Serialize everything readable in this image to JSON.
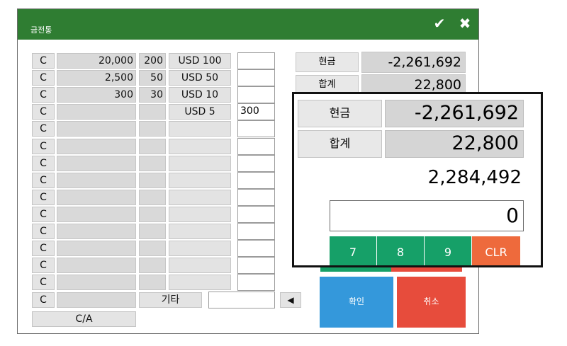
{
  "window": {
    "title": "금전통"
  },
  "icons": {
    "confirm": "check-icon",
    "close": "close-icon",
    "back": "arrow-left-icon"
  },
  "colors": {
    "titlebar": "#2f7d32",
    "confirm": "#3498db",
    "cancel": "#e74c3c",
    "keypad_green": "#16a068",
    "keypad_clr": "#ee6a3c"
  },
  "rows": [
    {
      "clear": "C",
      "amount": "20,000",
      "count": "200",
      "label": "USD 100",
      "input": ""
    },
    {
      "clear": "C",
      "amount": "2,500",
      "count": "50",
      "label": "USD 50",
      "input": ""
    },
    {
      "clear": "C",
      "amount": "300",
      "count": "30",
      "label": "USD 10",
      "input": ""
    },
    {
      "clear": "C",
      "amount": "",
      "count": "",
      "label": "USD 5",
      "input": "300"
    },
    {
      "clear": "C",
      "amount": "",
      "count": "",
      "label": "",
      "input": ""
    },
    {
      "clear": "C",
      "amount": "",
      "count": "",
      "label": "",
      "input": ""
    },
    {
      "clear": "C",
      "amount": "",
      "count": "",
      "label": "",
      "input": ""
    },
    {
      "clear": "C",
      "amount": "",
      "count": "",
      "label": "",
      "input": ""
    },
    {
      "clear": "C",
      "amount": "",
      "count": "",
      "label": "",
      "input": ""
    },
    {
      "clear": "C",
      "amount": "",
      "count": "",
      "label": "",
      "input": ""
    },
    {
      "clear": "C",
      "amount": "",
      "count": "",
      "label": "",
      "input": ""
    },
    {
      "clear": "C",
      "amount": "",
      "count": "",
      "label": "",
      "input": ""
    },
    {
      "clear": "C",
      "amount": "",
      "count": "",
      "label": "",
      "input": ""
    },
    {
      "clear": "C",
      "amount": "",
      "count": "",
      "label": "",
      "input": ""
    }
  ],
  "last_row": {
    "clear": "C",
    "other_label": "기타",
    "other_input": "",
    "back_symbol": "◀"
  },
  "ca_button": "C/A",
  "summary": {
    "cash_label": "현금",
    "cash_value": "-2,261,692",
    "total_label": "합계",
    "total_value": "22,800",
    "difference": "2,284,492",
    "entry_value": "0"
  },
  "keypad": [
    "7",
    "8",
    "9",
    "CLR"
  ],
  "actions": {
    "confirm_label": "확인",
    "cancel_label": "취소"
  }
}
